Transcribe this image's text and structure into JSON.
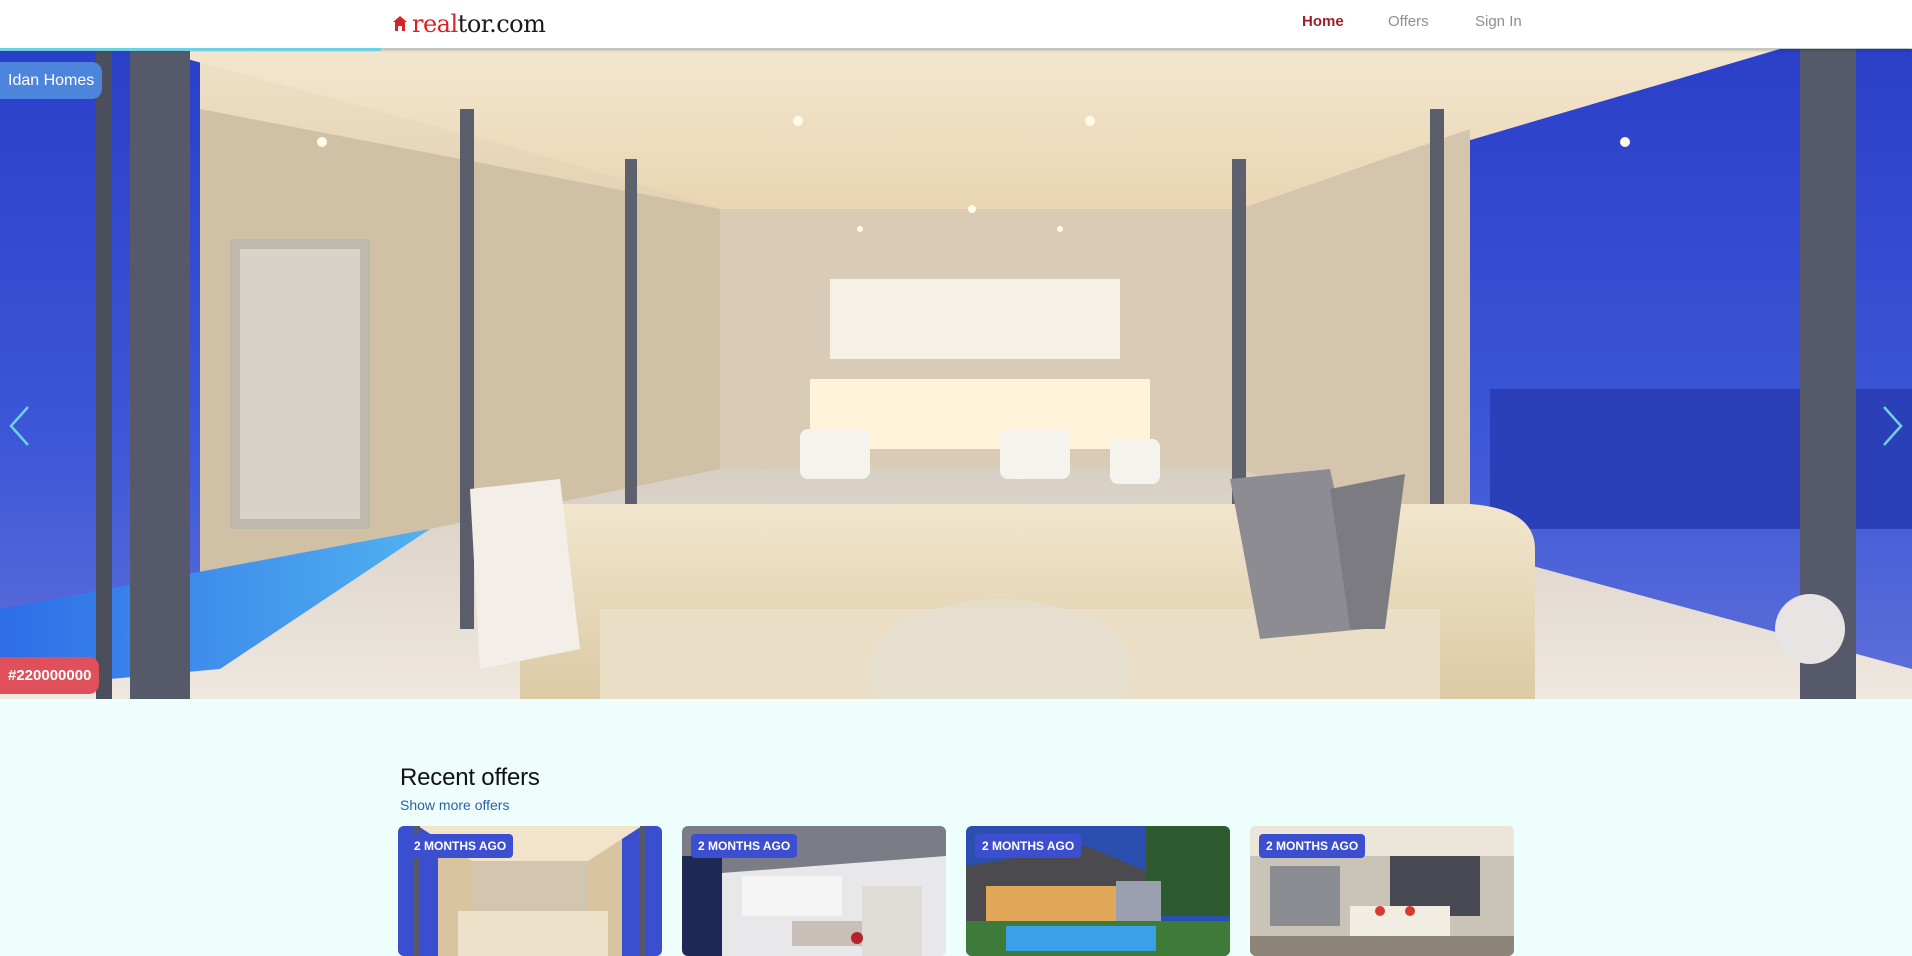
{
  "navbar": {
    "logo_real": "real",
    "logo_tor": "tor.com",
    "links": [
      {
        "label": "Home",
        "active": true
      },
      {
        "label": "Offers",
        "active": false
      },
      {
        "label": "Sign In",
        "active": false
      }
    ]
  },
  "hero": {
    "company_tag": "Idan Homes",
    "listing_id": "#220000000",
    "prev_icon": "chevron-left-icon",
    "next_icon": "chevron-right-icon"
  },
  "recent": {
    "title": "Recent offers",
    "show_more": "Show more offers",
    "cards": [
      {
        "badge": "2 MONTHS AGO"
      },
      {
        "badge": "2 MONTHS AGO"
      },
      {
        "badge": "2 MONTHS AGO"
      },
      {
        "badge": "2 MONTHS AGO"
      }
    ]
  },
  "colors": {
    "brand_red": "#d92228",
    "nav_active": "#a21c2c",
    "company_tag": "#4e85dc",
    "mls_tag": "#e0505a",
    "badge": "#3d4fd1",
    "page_bg": "#eefefd"
  }
}
